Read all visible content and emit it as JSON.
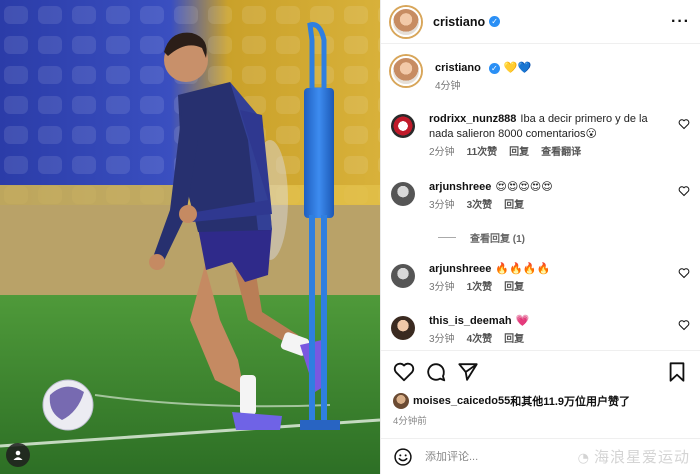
{
  "post": {
    "author": "cristiano",
    "caption_author": "cristiano",
    "caption_emojis": "💛💙",
    "caption_time": "4分钟"
  },
  "comments": [
    {
      "user": "rodrixx_nunz888",
      "text": "Iba a decir primero y de la nada salieron 8000 comentarios😮",
      "time": "2分钟",
      "likes": "11次赞",
      "reply": "回复",
      "translate": "查看翻译"
    },
    {
      "user": "arjunshreee",
      "text": "😍😍😍😍😍",
      "time": "3分钟",
      "likes": "3次赞",
      "reply": "回复",
      "view_replies": "查看回复 (1)"
    },
    {
      "user": "arjunshreee",
      "text": "🔥🔥🔥🔥",
      "time": "3分钟",
      "likes": "1次赞",
      "reply": "回复"
    },
    {
      "user": "this_is_deemah",
      "text": "💗",
      "time": "3分钟",
      "likes": "4次赞",
      "reply": "回复"
    }
  ],
  "likes": {
    "user": "moises_caicedo55",
    "suffix": "和其他11.9万位用户赞了"
  },
  "post_time": "4分钟前",
  "add_comment": {
    "placeholder": "添加评论..."
  },
  "watermark": "海浪星爱运动",
  "icons": {
    "like": "heart-icon",
    "comment": "comment-icon",
    "share": "send-icon",
    "save": "bookmark-icon",
    "emoji": "emoji-icon",
    "more": "more-icon",
    "tag": "user-tag-icon"
  },
  "colors": {
    "verified": "#2a8ff5",
    "seat_blue": "#3b4fc4",
    "seat_yellow": "#e8b923",
    "pitch": "#3f8f2f",
    "pole": "#2f7fe0",
    "kit": "#2a2f7a"
  }
}
